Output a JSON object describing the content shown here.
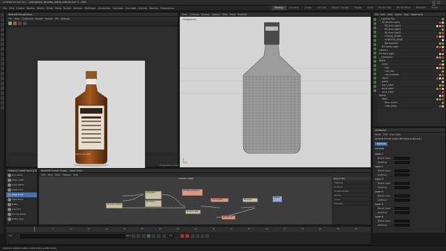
{
  "window": {
    "title": "Cinema 4D R20.057 - [orangebus_whiskey_bottle_tutorial.c4d *] - Main"
  },
  "menu": [
    "File",
    "Edit",
    "Create",
    "Modes",
    "Select",
    "Tools",
    "Mesh",
    "Spline",
    "Volume",
    "MoGraph",
    "Character",
    "Animate",
    "Simulate",
    "Tracker",
    "Render",
    "Extensions",
    "Window",
    "Help",
    "RENDERING Redshift"
  ],
  "layouts": [
    "Startup",
    "Animate",
    "Sculpt",
    "UV Edit",
    "Motion Tracker",
    "Model",
    "Paint",
    "BP-UV Edit",
    "BP-3D Paint",
    "Redshift",
    "Script",
    "Visualize",
    "Standard"
  ],
  "active_layout": "Startup",
  "render_view": {
    "panel_title": "Redshift RenderView",
    "menus": [
      "File",
      "View",
      "Customize",
      "Bucket",
      "Render",
      "IPR",
      "Settings"
    ],
    "status": "Frame: 0  2022.09.06  14:39:15  (1.29s)",
    "progress_label": "Progressive rendering"
  },
  "viewport": {
    "menus": [
      "View",
      "Cameras",
      "Display",
      "Options",
      "Filter",
      "Panel",
      "Redshift"
    ],
    "camera_label": "Perspective"
  },
  "object_manager": {
    "menus": [
      "File",
      "Edit",
      "View",
      "Object",
      "Tags",
      "Bookmarks"
    ],
    "rows": [
      {
        "name": "__Lighting Rig",
        "indent": 0
      },
      {
        "name": "RS Studio Lights",
        "indent": 1
      },
      {
        "name": "RS Area Light1",
        "indent": 2
      },
      {
        "name": "RS Area Light2",
        "indent": 2
      },
      {
        "name": "RS Area Light3",
        "indent": 2
      },
      {
        "name": "STUDIO_DOME",
        "indent": 2
      },
      {
        "name": "HORIZON_GENE",
        "indent": 2
      },
      {
        "name": "Background",
        "indent": 2
      },
      {
        "name": "RS Dome Light",
        "indent": 1
      },
      {
        "name": "Camera",
        "indent": 0
      },
      {
        "name": "RS Area Light",
        "indent": 0
      },
      {
        "name": "__Geometry",
        "indent": 0
      },
      {
        "name": "Bottle",
        "indent": 0
      },
      {
        "name": "Label",
        "indent": 1
      },
      {
        "name": "cap",
        "indent": 2
      },
      {
        "name": "cap_ring",
        "indent": 2
      },
      {
        "name": "cap_wrapper",
        "indent": 2
      },
      {
        "name": "liquid",
        "indent": 1
      },
      {
        "name": "bottle",
        "indent": 1
      },
      {
        "name": "front_label",
        "indent": 1
      },
      {
        "name": "back_label",
        "indent": 1
      },
      {
        "name": "neck_label",
        "indent": 1
      },
      {
        "name": "Bottle",
        "indent": 0
      },
      {
        "name": "Table",
        "indent": 1
      },
      {
        "name": "floor_plane",
        "indent": 2
      },
      {
        "name": "cube_base",
        "indent": 2
      }
    ]
  },
  "attributes": {
    "header": "Attributes",
    "menus": [
      "Mode",
      "Edit",
      "User Data"
    ],
    "object_title": "Redshift Shader Graph [RS Material Blender]",
    "tab": "General",
    "section": "General",
    "layers": [
      {
        "name": "Layer 1",
        "fields": [
          "Blend Color",
          "Additive"
        ]
      },
      {
        "name": "Layer 2",
        "fields": [
          "Blend Color",
          "Additive"
        ]
      },
      {
        "name": "Layer 3",
        "fields": [
          "Blend Color",
          "Additive"
        ]
      },
      {
        "name": "Layer 4",
        "fields": [
          "Blend Color",
          "Additive"
        ]
      },
      {
        "name": "Layer 5",
        "fields": [
          "Blend Color",
          "Additive"
        ]
      },
      {
        "name": "Layer 6",
        "fields": [
          "Blend Color",
          "Additive"
        ]
      }
    ]
  },
  "material_manager": {
    "menus": [
      "Create",
      "Edit",
      "View",
      "Select",
      "Material",
      "Texture",
      "Redshift"
    ],
    "tab_title": "Material: Label Front [Label Front]",
    "items": [
      "Fine Label",
      "Glass Label",
      "Glass Metal",
      "Glass Cork",
      "Label Front",
      "Label Back",
      "Bottle",
      "Gold Foil",
      "RS Cap Metal",
      "Bottle Stop"
    ]
  },
  "shader_graph": {
    "title": "Redshift Shader Graph - Label Front",
    "menus": [
      "Edit",
      "View",
      "Tools",
      "Options",
      "Help"
    ],
    "canvas_label": "Shader Graph",
    "nodes": [
      {
        "label": "RS Texture",
        "style": "plain"
      },
      {
        "label": "RS Texture",
        "style": "plain"
      },
      {
        "label": "RS Color Correct",
        "style": "plain"
      },
      {
        "label": "RS Material Blender",
        "style": "red"
      },
      {
        "label": "Color Splitter",
        "style": "red"
      },
      {
        "label": "RS Sprite",
        "style": "plain"
      },
      {
        "label": "Output",
        "style": "blue"
      },
      {
        "label": "RS Bump Map",
        "style": "plain"
      },
      {
        "label": "RS Material",
        "style": "red"
      }
    ],
    "side_panel_header": "Object Tab",
    "side_rows": [
      "Material",
      "Surface",
      "Displacement",
      "Bump",
      "Layer",
      "Shadow"
    ]
  },
  "timeline": {
    "start": "0 F",
    "end": "90 F",
    "current": "0 F",
    "ticks": [
      "0",
      "5",
      "10",
      "15",
      "20",
      "25",
      "30",
      "35",
      "40",
      "45",
      "50",
      "55",
      "60",
      "65",
      "70",
      "75",
      "80",
      "85",
      "90"
    ]
  },
  "status_bar": "Redshift Shader Graph: Label Front [Label Front]",
  "colors": {
    "accent": "#4a6fa5",
    "viewport_bg": "#d4d4d4",
    "render_bg": "#d9d9d9",
    "node_default": "#c9c2a8",
    "node_red": "#d49a8a",
    "node_blue": "#9aaed0"
  }
}
